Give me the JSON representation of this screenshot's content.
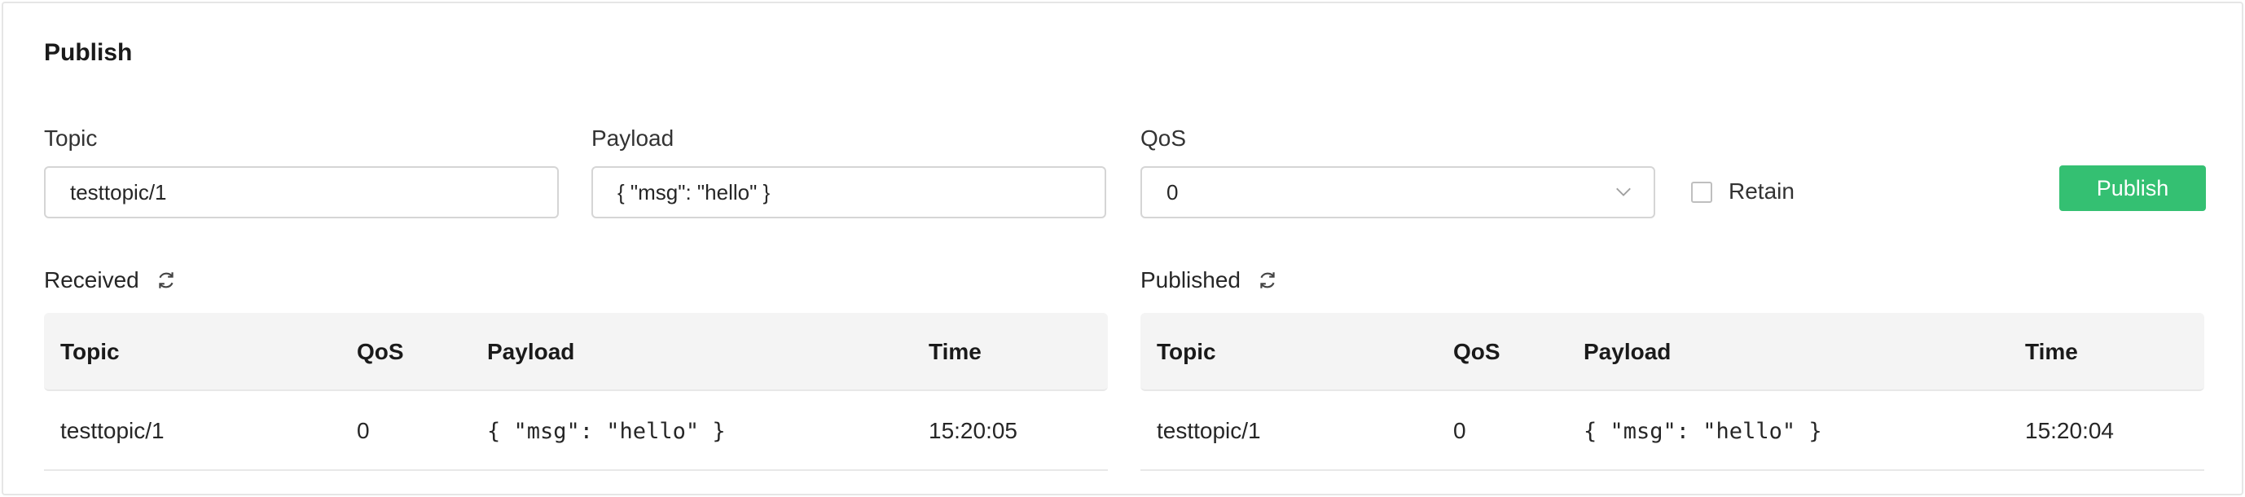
{
  "publish": {
    "title": "Publish",
    "topic": {
      "label": "Topic",
      "value": "testtopic/1"
    },
    "payload": {
      "label": "Payload",
      "value": "{ \"msg\": \"hello\" }"
    },
    "qos": {
      "label": "QoS",
      "value": "0"
    },
    "retain": {
      "label": "Retain",
      "checked": false
    },
    "button_label": "Publish"
  },
  "received": {
    "label": "Received",
    "columns": [
      "Topic",
      "QoS",
      "Payload",
      "Time"
    ],
    "rows": [
      {
        "topic": "testtopic/1",
        "qos": "0",
        "payload": "{ \"msg\": \"hello\" }",
        "time": "15:20:05"
      }
    ]
  },
  "published": {
    "label": "Published",
    "columns": [
      "Topic",
      "QoS",
      "Payload",
      "Time"
    ],
    "rows": [
      {
        "topic": "testtopic/1",
        "qos": "0",
        "payload": "{ \"msg\": \"hello\" }",
        "time": "15:20:04"
      }
    ]
  },
  "colors": {
    "accent": "#34c072",
    "header_bg": "#f4f4f4",
    "border": "#e6e6e6"
  },
  "icons": {
    "refresh": "refresh-icon",
    "dropdown": "chevron-down-icon"
  }
}
